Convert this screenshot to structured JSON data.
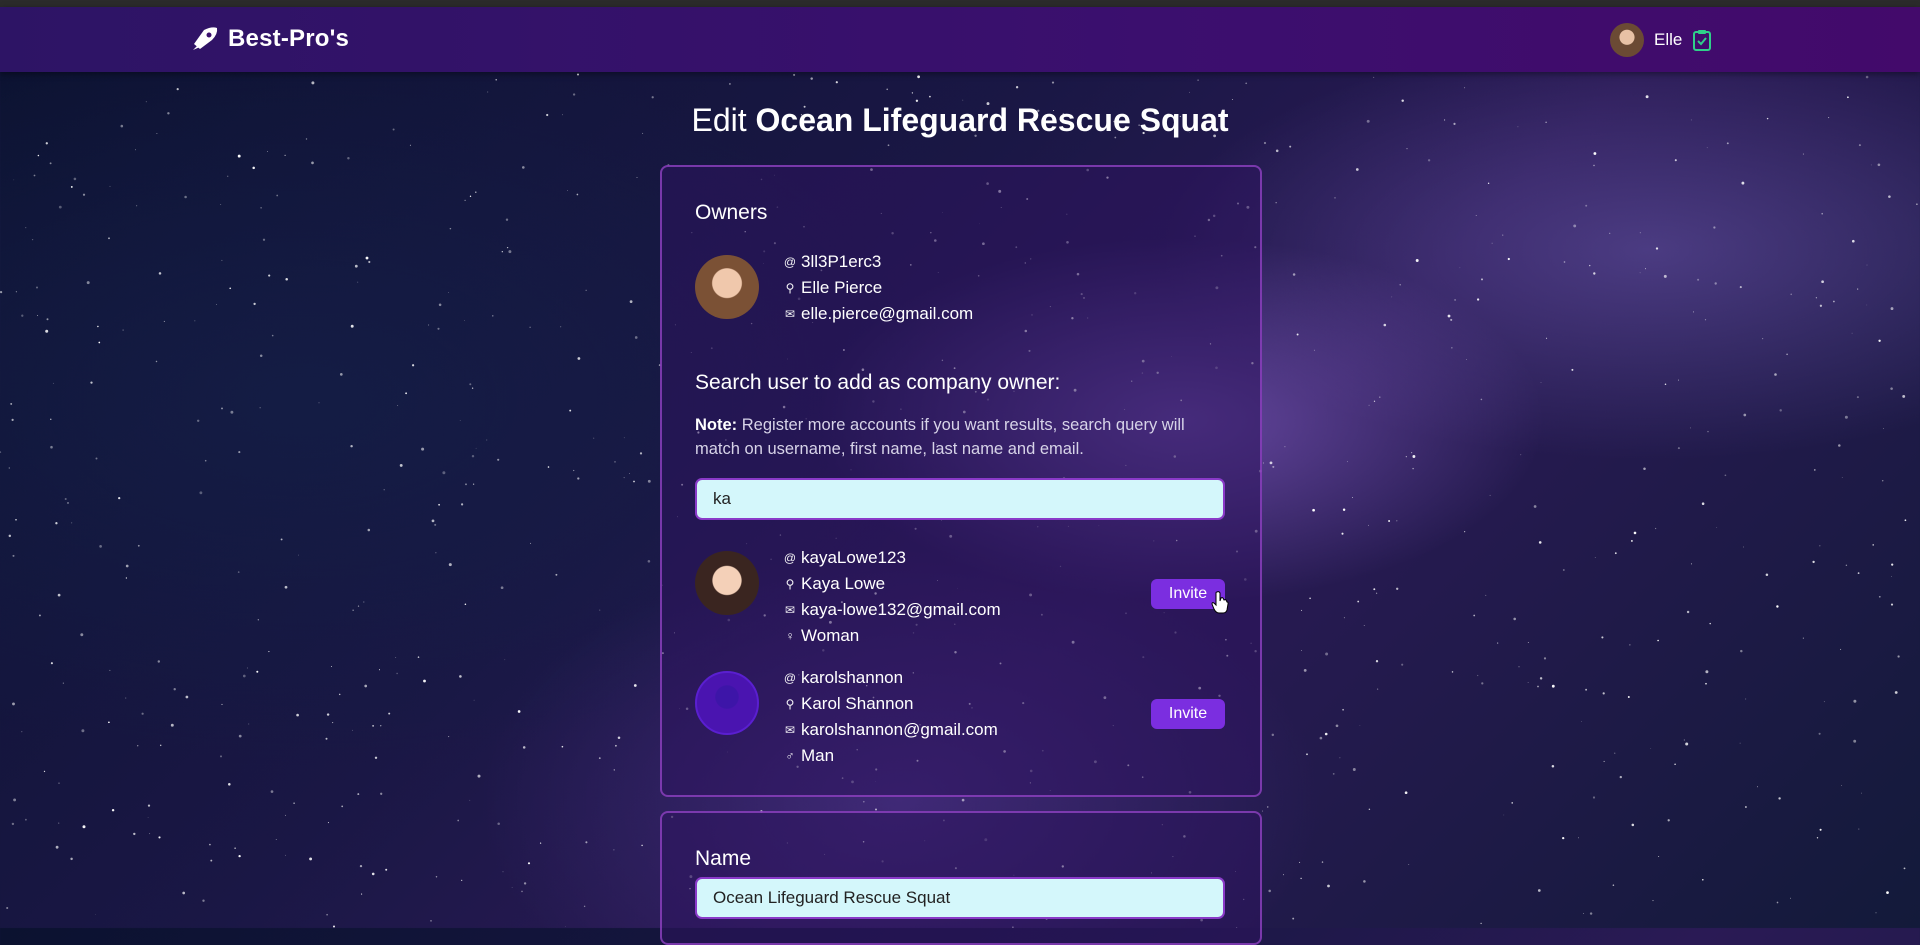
{
  "app": {
    "brand": "Best-Pro's",
    "user_name": "Elle"
  },
  "page": {
    "title_verb": "Edit",
    "title_name": "Ocean Lifeguard Rescue Squat"
  },
  "owners": {
    "title": "Owners",
    "list": [
      {
        "username": "3ll3P1erc3",
        "full_name": "Elle Pierce",
        "email": "elle.pierce@gmail.com"
      }
    ]
  },
  "search": {
    "title": "Search user to add as company owner:",
    "note_label": "Note:",
    "note_text": "Register more accounts if you want results, search query will match on username, first name, last name and email.",
    "query": "ka",
    "results": [
      {
        "username": "kayaLowe123",
        "full_name": "Kaya Lowe",
        "email": "kaya-lowe132@gmail.com",
        "gender": "Woman",
        "gender_icon": "♀",
        "invite_label": "Invite"
      },
      {
        "username": "karolshannon",
        "full_name": "Karol Shannon",
        "email": "karolshannon@gmail.com",
        "gender": "Man",
        "gender_icon": "♂",
        "invite_label": "Invite"
      }
    ]
  },
  "name_section": {
    "label": "Name",
    "value": "Ocean Lifeguard Rescue Squat"
  },
  "icons": {
    "username": "@",
    "name": "⚲",
    "email": "✉"
  },
  "colors": {
    "accent": "#7b2ee0",
    "navbar": "#3b0f6e",
    "input_bg": "#d4f7fb"
  }
}
